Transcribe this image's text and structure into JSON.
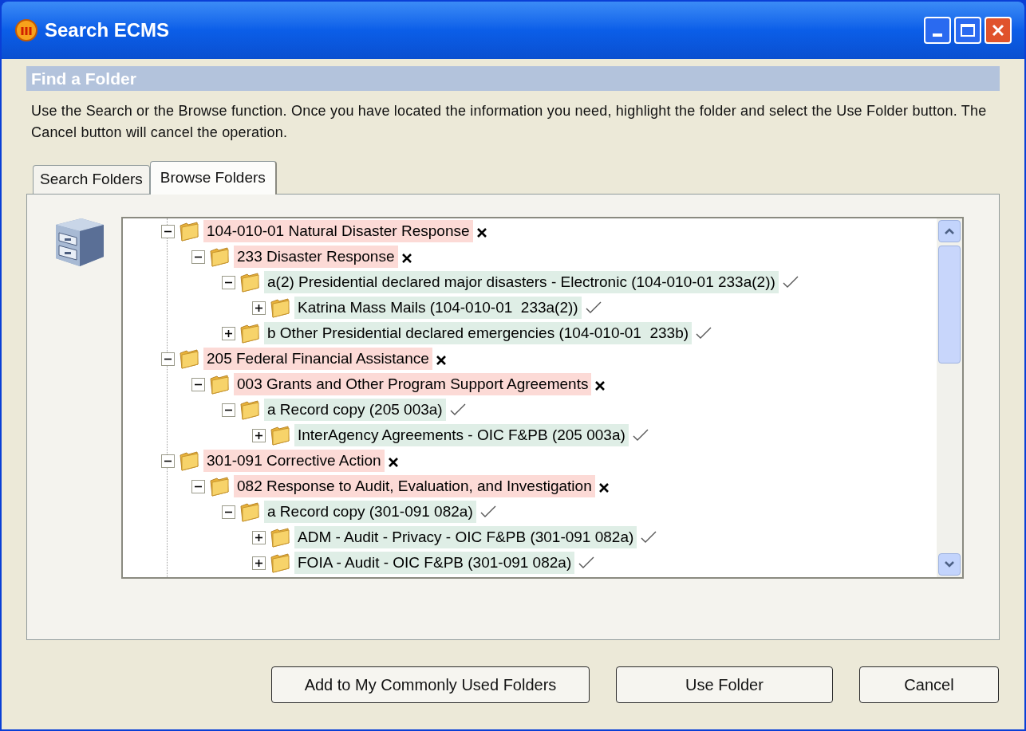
{
  "window": {
    "title": "Search ECMS"
  },
  "header": {
    "title": "Find a Folder"
  },
  "instructions": "Use the Search or the Browse function. Once you have located the information you need, highlight the folder and select the Use Folder button. The Cancel button will cancel the operation.",
  "tabs": [
    {
      "label": "Search Folders",
      "selected": false
    },
    {
      "label": "Browse Folders",
      "selected": true
    }
  ],
  "tree": [
    {
      "label": "104-010-01 Natural Disaster Response",
      "kind": "excluded",
      "expanded": true,
      "children": [
        {
          "label": "233 Disaster Response",
          "kind": "excluded",
          "expanded": true,
          "children": [
            {
              "label": "a(2) Presidential declared major disasters - Electronic (104-010-01 233a(2))",
              "kind": "included",
              "expanded": true,
              "children": [
                {
                  "label": "Katrina Mass Mails (104-010-01  233a(2))",
                  "kind": "included",
                  "expanded": false
                }
              ]
            },
            {
              "label": "b Other Presidential declared emergencies (104-010-01  233b)",
              "kind": "included",
              "expanded": false
            }
          ]
        }
      ]
    },
    {
      "label": "205 Federal Financial Assistance",
      "kind": "excluded",
      "expanded": true,
      "children": [
        {
          "label": "003 Grants and Other Program Support Agreements",
          "kind": "excluded",
          "expanded": true,
          "children": [
            {
              "label": "a Record copy (205 003a)",
              "kind": "included",
              "expanded": true,
              "children": [
                {
                  "label": "InterAgency Agreements - OIC F&PB (205 003a)",
                  "kind": "included",
                  "expanded": false
                }
              ]
            }
          ]
        }
      ]
    },
    {
      "label": "301-091 Corrective Action",
      "kind": "excluded",
      "expanded": true,
      "children": [
        {
          "label": "082 Response to Audit, Evaluation, and Investigation",
          "kind": "excluded",
          "expanded": true,
          "children": [
            {
              "label": "a Record copy (301-091 082a)",
              "kind": "included",
              "expanded": true,
              "children": [
                {
                  "label": "ADM - Audit - Privacy - OIC F&PB (301-091 082a)",
                  "kind": "included",
                  "expanded": false
                },
                {
                  "label": "FOIA - Audit - OIC F&PB (301-091 082a)",
                  "kind": "included",
                  "expanded": false
                }
              ]
            }
          ]
        }
      ]
    }
  ],
  "buttons": [
    "Add to My Commonly Used Folders",
    "Use Folder",
    "Cancel"
  ]
}
